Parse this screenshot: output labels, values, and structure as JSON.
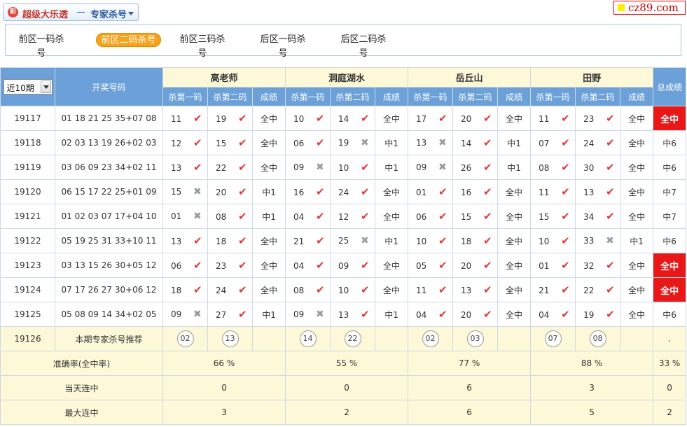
{
  "header": {
    "logo": "彩",
    "title": "超级大乐透",
    "separator": "—",
    "subtitle": "专家杀号",
    "site": "cz89.com"
  },
  "tabs": [
    "前区一码杀号",
    "前区二码杀号",
    "前区三码杀号",
    "后区一码杀号",
    "后区二码杀号"
  ],
  "active_tab": 1,
  "table": {
    "period_select": "近10期",
    "draw_header": "开奖号码",
    "experts": [
      "高老师",
      "洞庭湖水",
      "岳丘山",
      "田野"
    ],
    "sub_headers": [
      "杀第一码",
      "杀第二码",
      "成绩"
    ],
    "total_header": "总成绩",
    "rows": [
      {
        "issue": "19117",
        "draw": "01 18 21 25 35+07 08",
        "e": [
          [
            "11",
            1,
            "19",
            1,
            "全中"
          ],
          [
            "10",
            1,
            "14",
            1,
            "全中"
          ],
          [
            "17",
            1,
            "20",
            1,
            "全中"
          ],
          [
            "11",
            1,
            "23",
            1,
            "全中"
          ]
        ],
        "total": "全中",
        "hl": true
      },
      {
        "issue": "19118",
        "draw": "02 03 13 19 26+02 03",
        "e": [
          [
            "12",
            1,
            "15",
            1,
            "全中"
          ],
          [
            "06",
            1,
            "19",
            0,
            "中1"
          ],
          [
            "13",
            0,
            "14",
            1,
            "中1"
          ],
          [
            "07",
            1,
            "24",
            1,
            "全中"
          ]
        ],
        "total": "中6",
        "hl": false
      },
      {
        "issue": "19119",
        "draw": "03 06 09 23 34+02 11",
        "e": [
          [
            "13",
            1,
            "22",
            1,
            "全中"
          ],
          [
            "09",
            0,
            "10",
            1,
            "中1"
          ],
          [
            "09",
            0,
            "26",
            1,
            "中1"
          ],
          [
            "08",
            1,
            "30",
            1,
            "全中"
          ]
        ],
        "total": "中6",
        "hl": false
      },
      {
        "issue": "19120",
        "draw": "06 15 17 22 25+01 09",
        "e": [
          [
            "15",
            0,
            "20",
            1,
            "中1"
          ],
          [
            "16",
            1,
            "24",
            1,
            "全中"
          ],
          [
            "01",
            1,
            "16",
            1,
            "全中"
          ],
          [
            "11",
            1,
            "13",
            1,
            "全中"
          ]
        ],
        "total": "中7",
        "hl": false
      },
      {
        "issue": "19121",
        "draw": "01 02 03 07 17+04 10",
        "e": [
          [
            "01",
            0,
            "08",
            1,
            "中1"
          ],
          [
            "04",
            1,
            "12",
            1,
            "全中"
          ],
          [
            "06",
            1,
            "15",
            1,
            "全中"
          ],
          [
            "15",
            1,
            "34",
            1,
            "全中"
          ]
        ],
        "total": "中7",
        "hl": false
      },
      {
        "issue": "19122",
        "draw": "05 19 25 31 33+10 11",
        "e": [
          [
            "13",
            1,
            "18",
            1,
            "全中"
          ],
          [
            "21",
            1,
            "25",
            0,
            "中1"
          ],
          [
            "10",
            1,
            "18",
            1,
            "全中"
          ],
          [
            "10",
            1,
            "33",
            0,
            "中1"
          ]
        ],
        "total": "中6",
        "hl": false
      },
      {
        "issue": "19123",
        "draw": "03 13 15 26 30+05 12",
        "e": [
          [
            "06",
            1,
            "23",
            1,
            "全中"
          ],
          [
            "04",
            1,
            "09",
            1,
            "全中"
          ],
          [
            "05",
            1,
            "20",
            1,
            "全中"
          ],
          [
            "01",
            1,
            "32",
            1,
            "全中"
          ]
        ],
        "total": "全中",
        "hl": true
      },
      {
        "issue": "19124",
        "draw": "07 17 26 27 30+06 12",
        "e": [
          [
            "18",
            1,
            "24",
            1,
            "全中"
          ],
          [
            "08",
            1,
            "10",
            1,
            "全中"
          ],
          [
            "11",
            1,
            "13",
            1,
            "全中"
          ],
          [
            "21",
            1,
            "22",
            1,
            "全中"
          ]
        ],
        "total": "全中",
        "hl": true
      },
      {
        "issue": "19125",
        "draw": "05 08 09 14 34+02 05",
        "e": [
          [
            "09",
            0,
            "27",
            1,
            "中1"
          ],
          [
            "09",
            0,
            "13",
            1,
            "中1"
          ],
          [
            "04",
            1,
            "20",
            1,
            "全中"
          ],
          [
            "04",
            1,
            "19",
            1,
            "全中"
          ]
        ],
        "total": "中6",
        "hl": false
      }
    ],
    "recommend": {
      "issue": "19126",
      "label": "本期专家杀号推荐",
      "picks": [
        [
          "02",
          "13"
        ],
        [
          "14",
          "22"
        ],
        [
          "02",
          "03"
        ],
        [
          "07",
          "08"
        ]
      ],
      "total": "."
    },
    "stats": [
      {
        "label": "准确率(全中率)",
        "values": [
          "66 %",
          "55 %",
          "77 %",
          "88 %"
        ],
        "total": "33 %"
      },
      {
        "label": "当天连中",
        "values": [
          "0",
          "0",
          "6",
          "3"
        ],
        "total": "0"
      },
      {
        "label": "最大连中",
        "values": [
          "3",
          "2",
          "6",
          "5"
        ],
        "total": "2"
      }
    ]
  }
}
